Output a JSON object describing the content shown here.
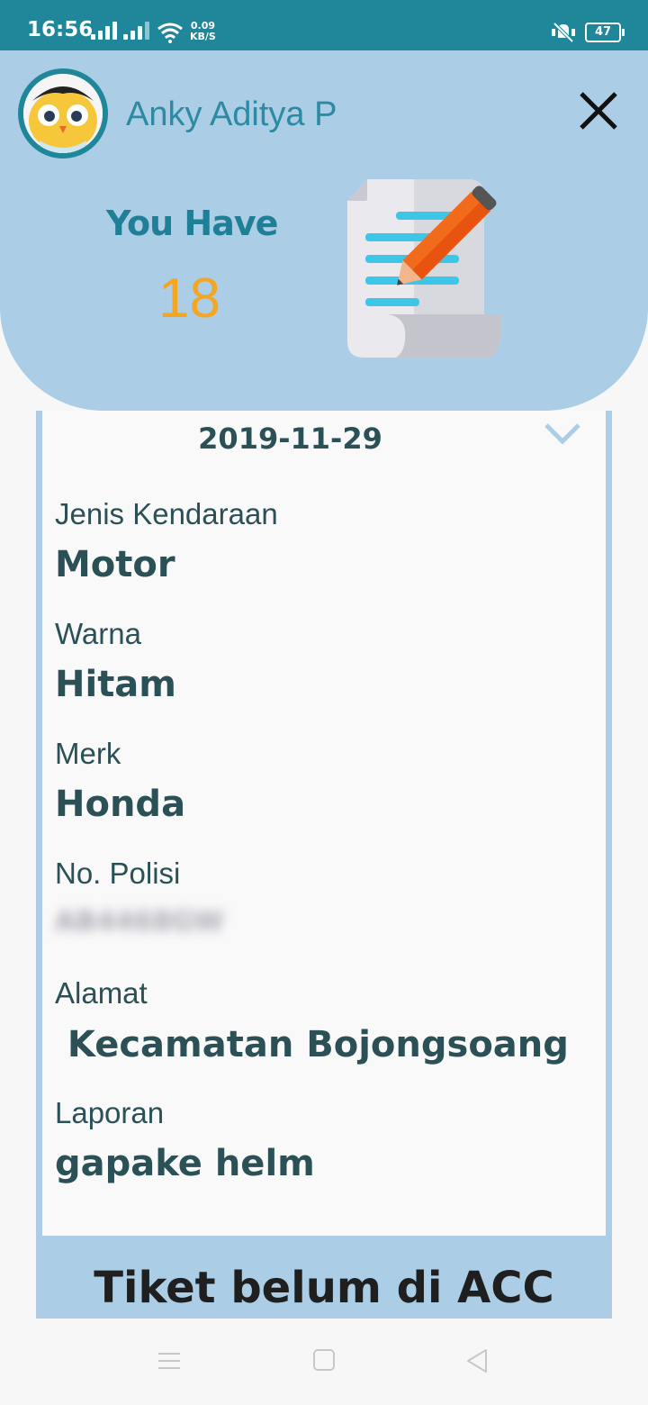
{
  "status_bar": {
    "time": "16:56",
    "net_speed_value": "0.09",
    "net_speed_unit": "KB/S",
    "battery": "47"
  },
  "header": {
    "user_name": "Anky Aditya P",
    "you_have_label": "You Have",
    "ticket_count": "18"
  },
  "ticket": {
    "date": "2019-11-29",
    "fields": [
      {
        "label": "Jenis Kendaraan",
        "value": "Motor"
      },
      {
        "label": "Warna",
        "value": "Hitam"
      },
      {
        "label": "Merk",
        "value": "Honda"
      },
      {
        "label": "No. Polisi",
        "value": "AB4468GW"
      },
      {
        "label": "Alamat",
        "value": " Kecamatan Bojongsoang"
      },
      {
        "label": "Laporan",
        "value": "gapake helm"
      }
    ],
    "status": "Tiket belum di ACC"
  },
  "colors": {
    "status_bar": "#20869a",
    "header_bg": "#abcde6",
    "accent_text": "#1e7f96",
    "count": "#f4a623",
    "field_text": "#2b5157"
  },
  "icons": [
    "signal-icon",
    "wifi-icon",
    "mute-icon",
    "battery-icon",
    "avatar",
    "close-icon",
    "document-pencil-icon",
    "chevron-down-icon",
    "menu-icon",
    "home-icon",
    "back-icon"
  ]
}
